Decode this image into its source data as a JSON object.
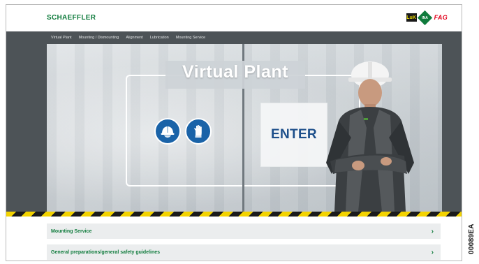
{
  "header": {
    "logo": "SCHAEFFLER",
    "brands": {
      "luk": "LuK",
      "ina": "INA",
      "fag": "FAG"
    }
  },
  "nav": {
    "items": [
      "Virtual Plant",
      "Mounting / Dismounting",
      "Alignment",
      "Lubrication",
      "Mounting Service"
    ]
  },
  "hero": {
    "title": "Virtual Plant",
    "enter_label": "ENTER",
    "icons": [
      "helmet-icon",
      "glove-icon"
    ]
  },
  "list": {
    "items": [
      {
        "label": "Mounting Service",
        "chevron": "›"
      },
      {
        "label": "General preparations/general safety guidelines",
        "chevron": "›"
      }
    ]
  },
  "figure_code": "00089EA",
  "colors": {
    "brand_green": "#0f7b3c",
    "nav_bg": "#4d5357",
    "icon_blue": "#1a63a8",
    "enter_blue": "#1c4e8a",
    "hazard_yellow": "#f3d300"
  }
}
